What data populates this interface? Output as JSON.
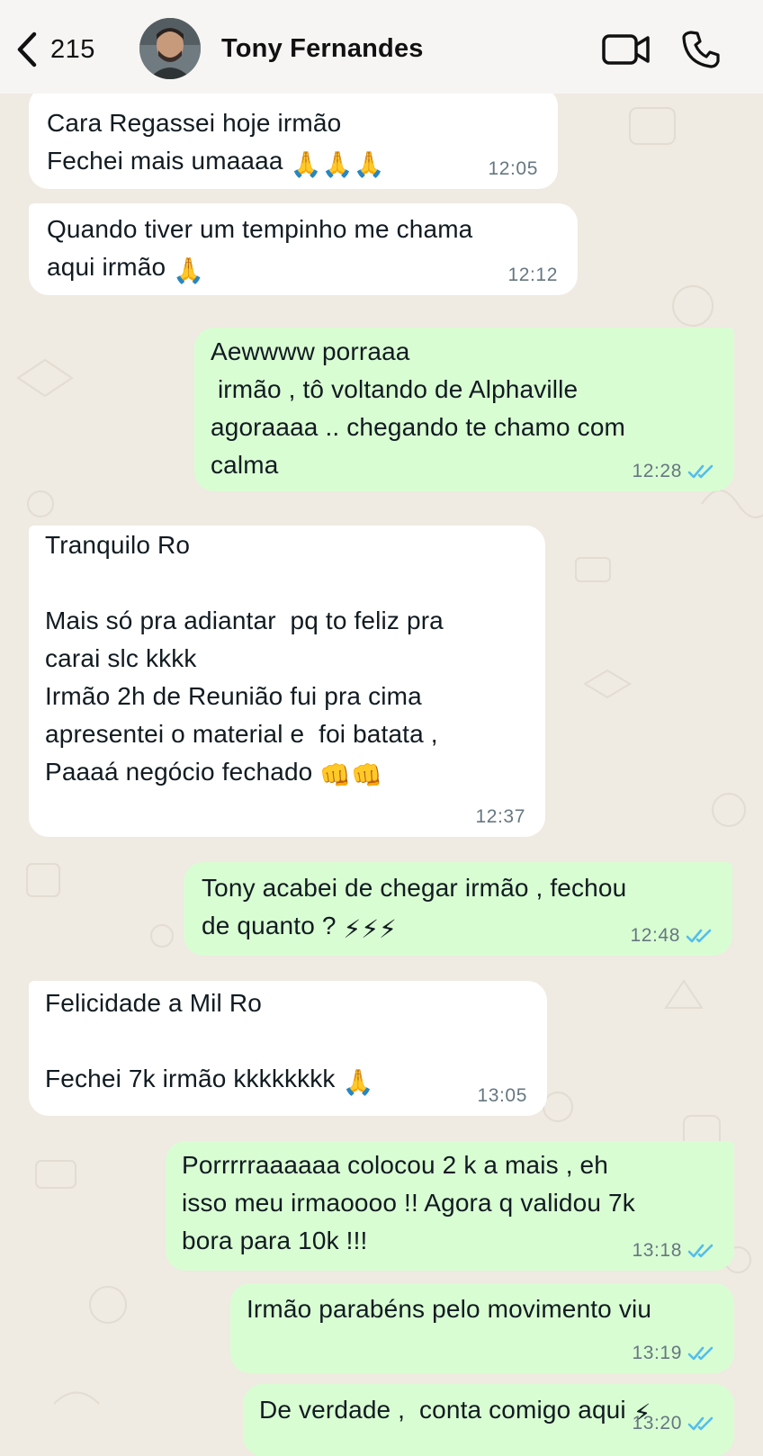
{
  "header": {
    "back_count": "215",
    "contact_name": "Tony Fernandes",
    "icons": [
      "chevron-left-icon",
      "video-call-icon",
      "phone-icon"
    ]
  },
  "colors": {
    "incoming_bubble": "#ffffff",
    "outgoing_bubble": "#d9fdd3",
    "read_ticks": "#53bdeb",
    "wallpaper": "#efeae2"
  },
  "messages": [
    {
      "direction": "in",
      "lines": [
        "Cara Regassei hoje irmão",
        "Fechei mais umaaaa"
      ],
      "emoji": "🙏🙏🙏",
      "time": "12:05"
    },
    {
      "direction": "in",
      "lines": [
        "Quando tiver um tempinho me chama",
        "aqui irmão"
      ],
      "emoji": "🙏",
      "time": "12:12"
    },
    {
      "direction": "out",
      "lines": [
        "Aewwww porraaa",
        " irmão , tô voltando de Alphaville",
        "agoraaaa .. chegando te chamo com",
        "calma"
      ],
      "time": "12:28",
      "status": "read"
    },
    {
      "direction": "in",
      "lines": [
        "Tranquilo Ro",
        "",
        "Mais só pra adiantar  pq to feliz pra",
        "carai slc kkkk",
        "Irmão 2h de Reunião fui pra cima",
        "apresentei o material e  foi batata ,",
        "Paaaá negócio fechado"
      ],
      "emoji": "👊👊",
      "time": "12:37"
    },
    {
      "direction": "out",
      "lines": [
        "Tony acabei de chegar irmão , fechou",
        "de quanto ?"
      ],
      "emoji": "⚡⚡⚡",
      "time": "12:48",
      "status": "read"
    },
    {
      "direction": "in",
      "lines": [
        "Felicidade a Mil Ro",
        "",
        "Fechei 7k irmão kkkkkkkk"
      ],
      "emoji": "🙏",
      "time": "13:05"
    },
    {
      "direction": "out",
      "lines": [
        "Porrrrraaaaaa colocou 2 k a mais , eh",
        "isso meu irmaoooo !! Agora q validou 7k",
        "bora para 10k !!!"
      ],
      "time": "13:18",
      "status": "read"
    },
    {
      "direction": "out",
      "lines": [
        "Irmão parabéns pelo movimento viu"
      ],
      "time": "13:19",
      "status": "read"
    },
    {
      "direction": "out",
      "lines": [
        "De verdade ,  conta comigo aqui"
      ],
      "emoji": "⚡",
      "time": "13:20",
      "status": "read"
    }
  ]
}
